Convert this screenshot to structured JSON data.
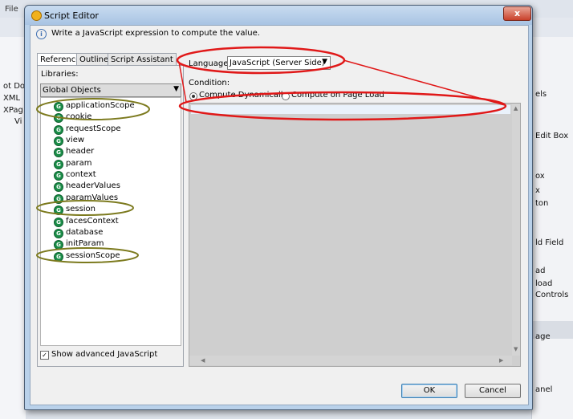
{
  "ide": {
    "menu_label": "File",
    "left_items": [
      "ot Doc",
      "XML",
      "XPag",
      "Vi"
    ],
    "right_items": [
      "els",
      "Edit Box",
      "ox",
      "x",
      "ton",
      "ld Field",
      "ad",
      "load",
      "Controls",
      "age",
      "anel"
    ]
  },
  "dialog": {
    "title": "Script Editor",
    "close_label": "x",
    "info_text": "Write a JavaScript expression to compute the value.",
    "tabs": [
      {
        "label": "Reference",
        "active": true
      },
      {
        "label": "Outline",
        "active": false
      },
      {
        "label": "Script Assistant",
        "active": false
      }
    ],
    "libraries_label": "Libraries:",
    "libraries_value": "Global Objects",
    "objects": [
      {
        "label": "applicationScope",
        "highlighted": true
      },
      {
        "label": "cookie",
        "highlighted": true
      },
      {
        "label": "requestScope",
        "highlighted": false
      },
      {
        "label": "view",
        "highlighted": false
      },
      {
        "label": "header",
        "highlighted": false
      },
      {
        "label": "param",
        "highlighted": false
      },
      {
        "label": "context",
        "highlighted": false
      },
      {
        "label": "headerValues",
        "highlighted": false
      },
      {
        "label": "paramValues",
        "highlighted": false
      },
      {
        "label": "session",
        "highlighted": true
      },
      {
        "label": "facesContext",
        "highlighted": false
      },
      {
        "label": "database",
        "highlighted": false
      },
      {
        "label": "initParam",
        "highlighted": false
      },
      {
        "label": "sessionScope",
        "highlighted": true
      }
    ],
    "show_advanced_label": "Show advanced JavaScript",
    "show_advanced_checked": true,
    "language_label": "Language:",
    "language_value": "JavaScript (Server Side)",
    "condition_label": "Condition:",
    "compute_dynamic_label": "Compute Dynamically",
    "compute_dynamic_selected": true,
    "compute_load_label": "Compute on Page Load",
    "compute_load_selected": false,
    "ok_label": "OK",
    "cancel_label": "Cancel"
  },
  "colors": {
    "annotation_green": "#7c7a1e",
    "annotation_red": "#e01818",
    "object_icon": "#1b8f49"
  }
}
